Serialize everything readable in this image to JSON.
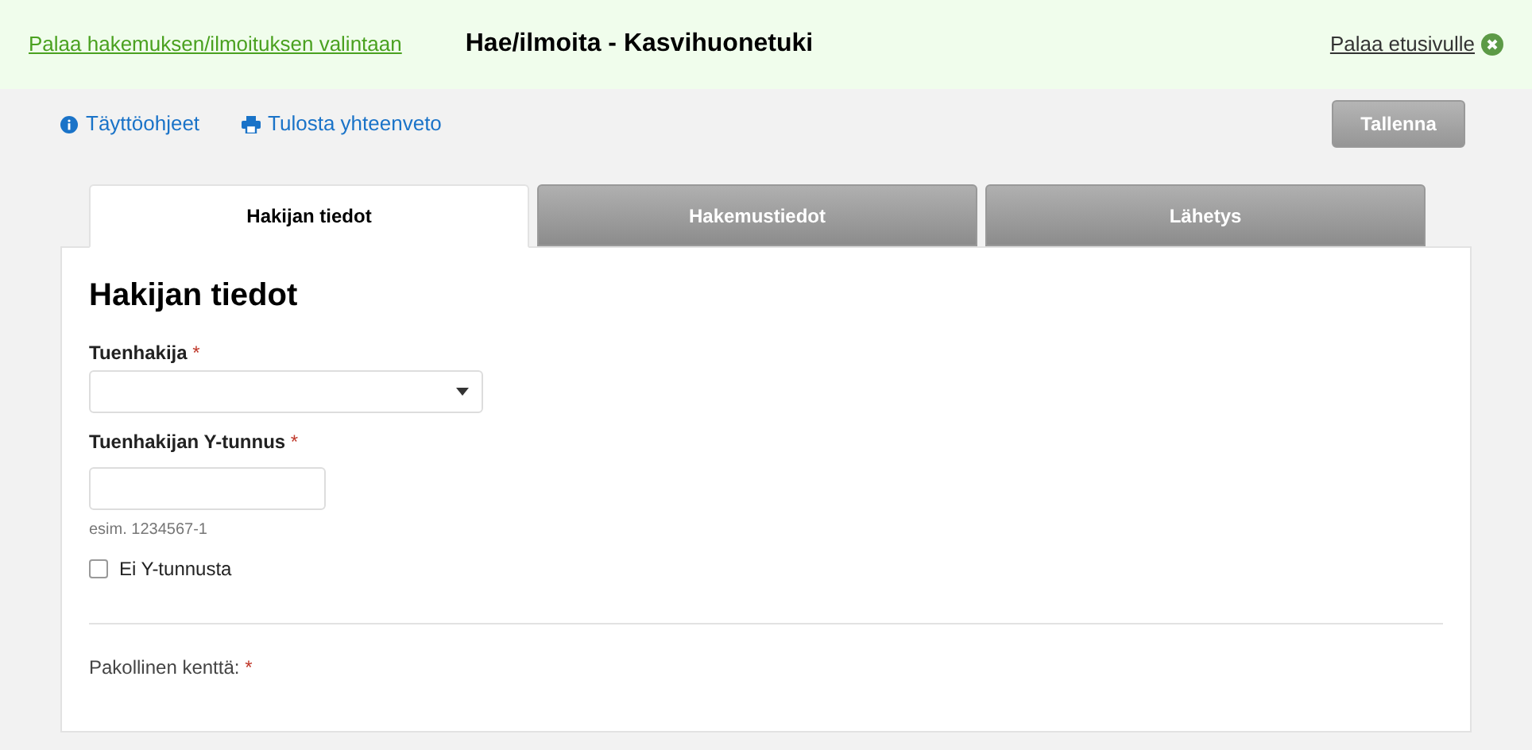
{
  "header": {
    "back_link": "Palaa hakemuksen/ilmoituksen valintaan",
    "title": "Hae/ilmoita - Kasvihuonetuki",
    "home_link": "Palaa etusivulle"
  },
  "toolbar": {
    "links": [
      {
        "kind": "info",
        "label": "Täyttöohjeet"
      },
      {
        "kind": "print",
        "label": "Tulosta yhteenveto"
      }
    ],
    "save_button": {
      "label": "Tallenna",
      "disabled": true
    }
  },
  "tabs": [
    {
      "label": "Hakijan tiedot",
      "selected": true
    },
    {
      "label": "Hakemustiedot",
      "selected": false
    },
    {
      "label": "Lähetys",
      "selected": false
    }
  ],
  "form": {
    "heading": "Hakijan tiedot",
    "fields": [
      {
        "kind": "select",
        "label": "Tuenhakija",
        "required_mark": "*"
      },
      {
        "kind": "text",
        "label": "Tuenhakijan Y-tunnus",
        "required_mark": "*",
        "hint": "esim. 1234567-1"
      }
    ],
    "checkbox": {
      "label": "Ei Y-tunnusta",
      "checked": false
    },
    "required_note": {
      "label": "Pakollinen kenttä:",
      "mark": "*"
    }
  }
}
